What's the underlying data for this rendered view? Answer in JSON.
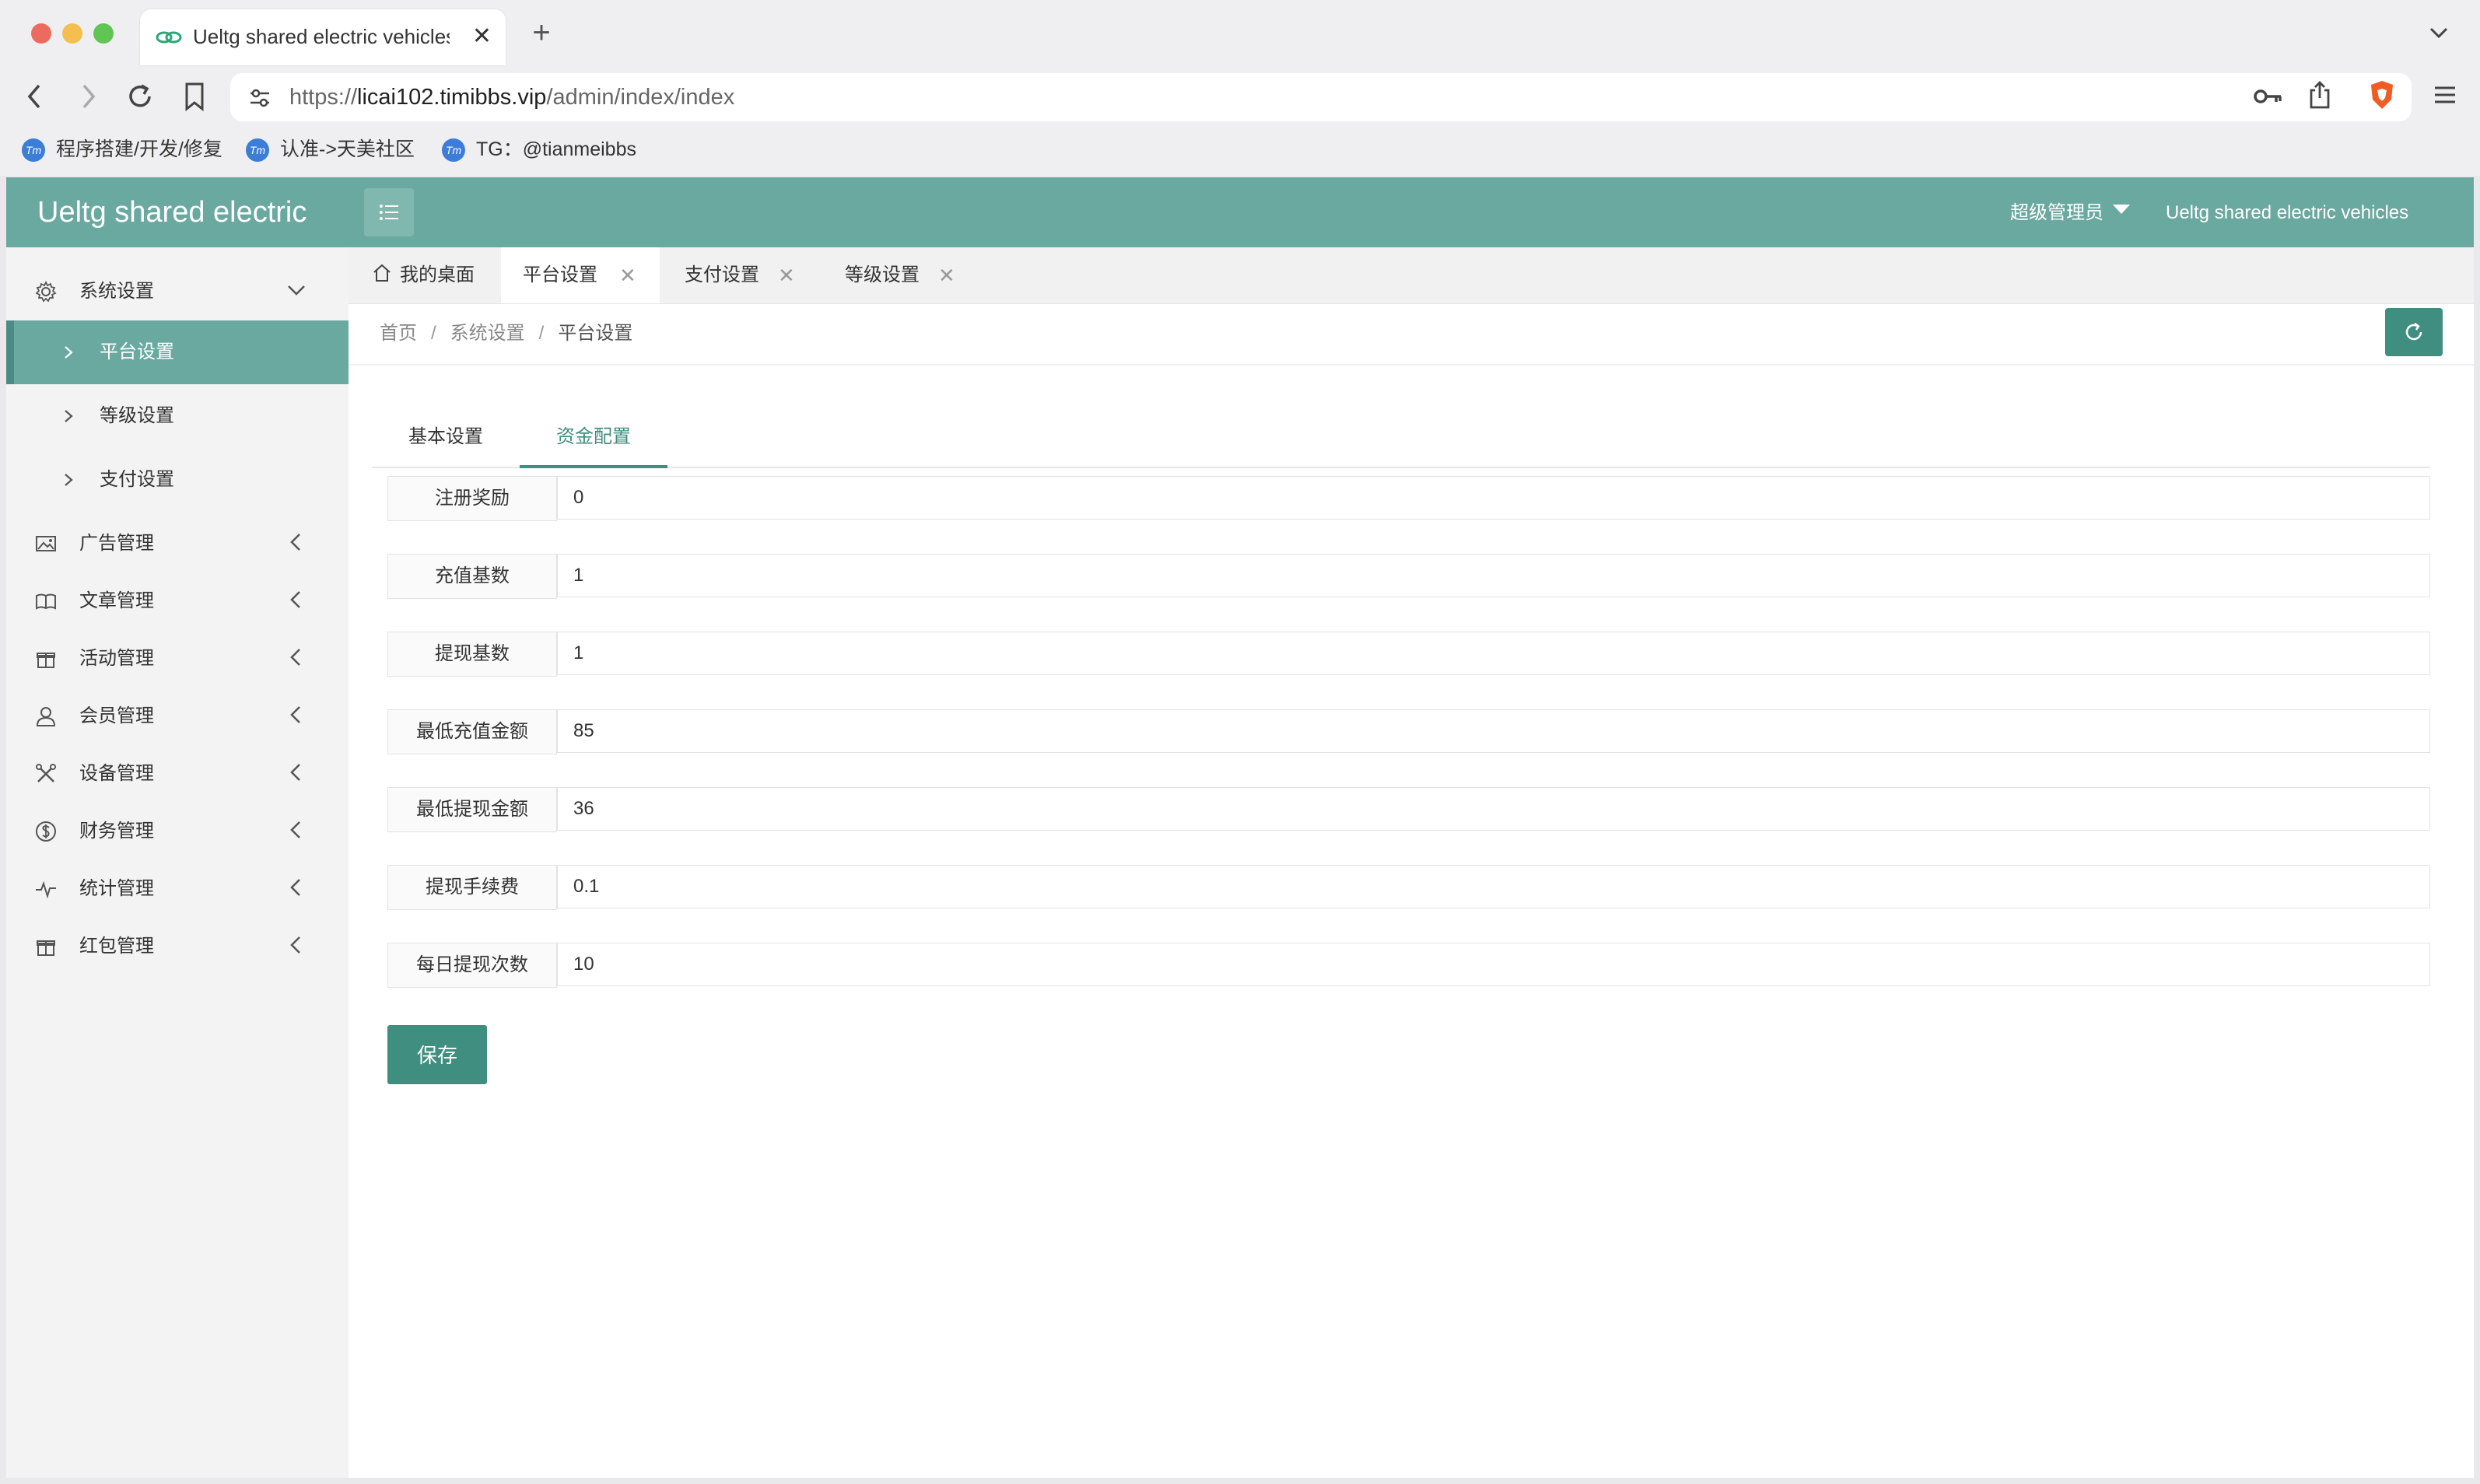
{
  "browser": {
    "tab_title": "Ueltg shared electric vehicles",
    "tab_close": "✕",
    "new_tab": "+",
    "url_prefix": "https://",
    "url_host": "licai102.timibbs.vip",
    "url_path": "/admin/index/index",
    "bookmarks": [
      {
        "label": "程序搭建/开发/修复"
      },
      {
        "label": "认准->天美社区"
      },
      {
        "label": "TG：@tianmeibbs"
      }
    ],
    "bookmark_icon_text": "Tm",
    "colors": {
      "close": "#ed6a5e",
      "minimize": "#f5bf4f",
      "maximize": "#61c554"
    }
  },
  "topbar": {
    "brand": "Ueltg shared electric",
    "admin_label": "超级管理员",
    "site_name": "Ueltg shared electric vehicles",
    "accent": "#6aa9a0"
  },
  "sidebar": {
    "system_settings": {
      "label": "系统设置",
      "icon": "gear-icon"
    },
    "sub_items": [
      {
        "label": "平台设置",
        "active": true
      },
      {
        "label": "等级设置",
        "active": false
      },
      {
        "label": "支付设置",
        "active": false
      }
    ],
    "groups": [
      {
        "label": "广告管理",
        "icon": "image-icon"
      },
      {
        "label": "文章管理",
        "icon": "book-icon"
      },
      {
        "label": "活动管理",
        "icon": "gift-icon"
      },
      {
        "label": "会员管理",
        "icon": "user-icon"
      },
      {
        "label": "设备管理",
        "icon": "tools-icon"
      },
      {
        "label": "财务管理",
        "icon": "dollar-icon"
      },
      {
        "label": "统计管理",
        "icon": "pulse-icon"
      },
      {
        "label": "红包管理",
        "icon": "gift-icon"
      }
    ]
  },
  "tabs": [
    {
      "label": "我的桌面",
      "icon": "home-icon"
    },
    {
      "label": "平台设置",
      "active": true
    },
    {
      "label": "支付设置"
    },
    {
      "label": "等级设置"
    }
  ],
  "tab_close_glyph": "✕",
  "breadcrumb": {
    "items": [
      "首页",
      "系统设置"
    ],
    "current": "平台设置",
    "separator": "/"
  },
  "form": {
    "tabs": [
      {
        "label": "基本设置",
        "active": false
      },
      {
        "label": "资金配置",
        "active": true
      }
    ],
    "fields": [
      {
        "label": "注册奖励",
        "value": "0"
      },
      {
        "label": "充值基数",
        "value": "1"
      },
      {
        "label": "提现基数",
        "value": "1"
      },
      {
        "label": "最低充值金额",
        "value": "85"
      },
      {
        "label": "最低提现金额",
        "value": "36"
      },
      {
        "label": "提现手续费",
        "value": "0.1"
      },
      {
        "label": "每日提现次数",
        "value": "10"
      }
    ],
    "save_label": "保存",
    "button_color": "#3f8e7f"
  }
}
